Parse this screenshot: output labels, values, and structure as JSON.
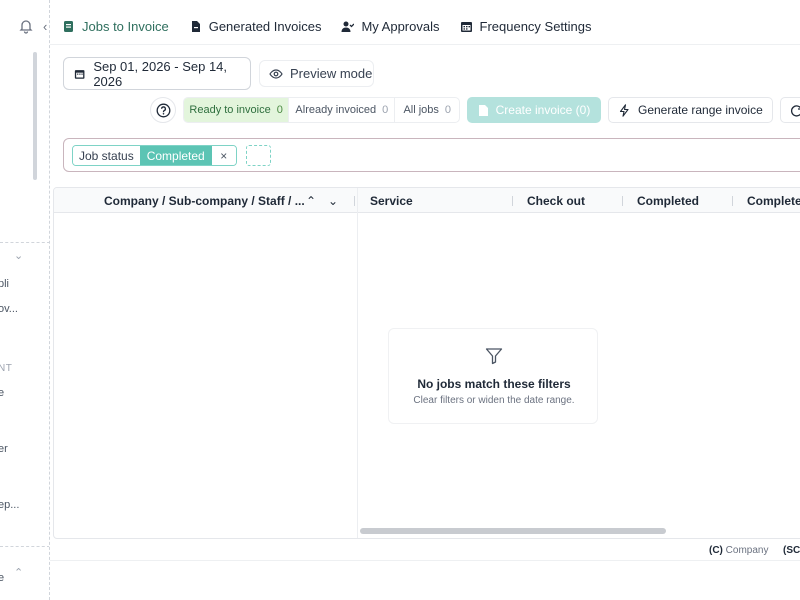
{
  "sidebar": {
    "partial_labels": [
      "pli",
      "ov...",
      "NT",
      "e",
      "er",
      "ep...",
      "e"
    ]
  },
  "tabs": [
    {
      "label": "Jobs to Invoice",
      "icon": "receipt-icon",
      "active": true
    },
    {
      "label": "Generated Invoices",
      "icon": "document-icon",
      "active": false
    },
    {
      "label": "My Approvals",
      "icon": "user-check-icon",
      "active": false
    },
    {
      "label": "Frequency Settings",
      "icon": "calendar-icon",
      "active": false
    }
  ],
  "toolbar": {
    "date_range": "Sep 01, 2026 - Sep 14, 2026",
    "preview_label": "Preview mode",
    "segments": [
      {
        "label": "Ready to invoice",
        "count": "0",
        "active": true
      },
      {
        "label": "Already invoiced",
        "count": "0",
        "active": false
      },
      {
        "label": "All jobs",
        "count": "0",
        "active": false
      }
    ],
    "create_label": "Create invoice (0)",
    "generate_label": "Generate range invoice"
  },
  "filter": {
    "key": "Job status",
    "value": "Completed",
    "remove": "×"
  },
  "table": {
    "columns": [
      "Company / Sub-company / Staff / ...",
      "Service",
      "Check out",
      "Completed",
      "Complete"
    ],
    "empty_title": "No jobs match these filters",
    "empty_subtitle": "Clear filters or widen the date range."
  },
  "footer": {
    "legend_company_code": "(C)",
    "legend_company_label": "Company",
    "legend_next_code": "(SC"
  },
  "colors": {
    "accent": "#2f6f5e",
    "segment_active_bg": "#e3f5dc",
    "create_button_bg": "#b4e2dd",
    "chip_value_bg": "#5cc4b4"
  }
}
